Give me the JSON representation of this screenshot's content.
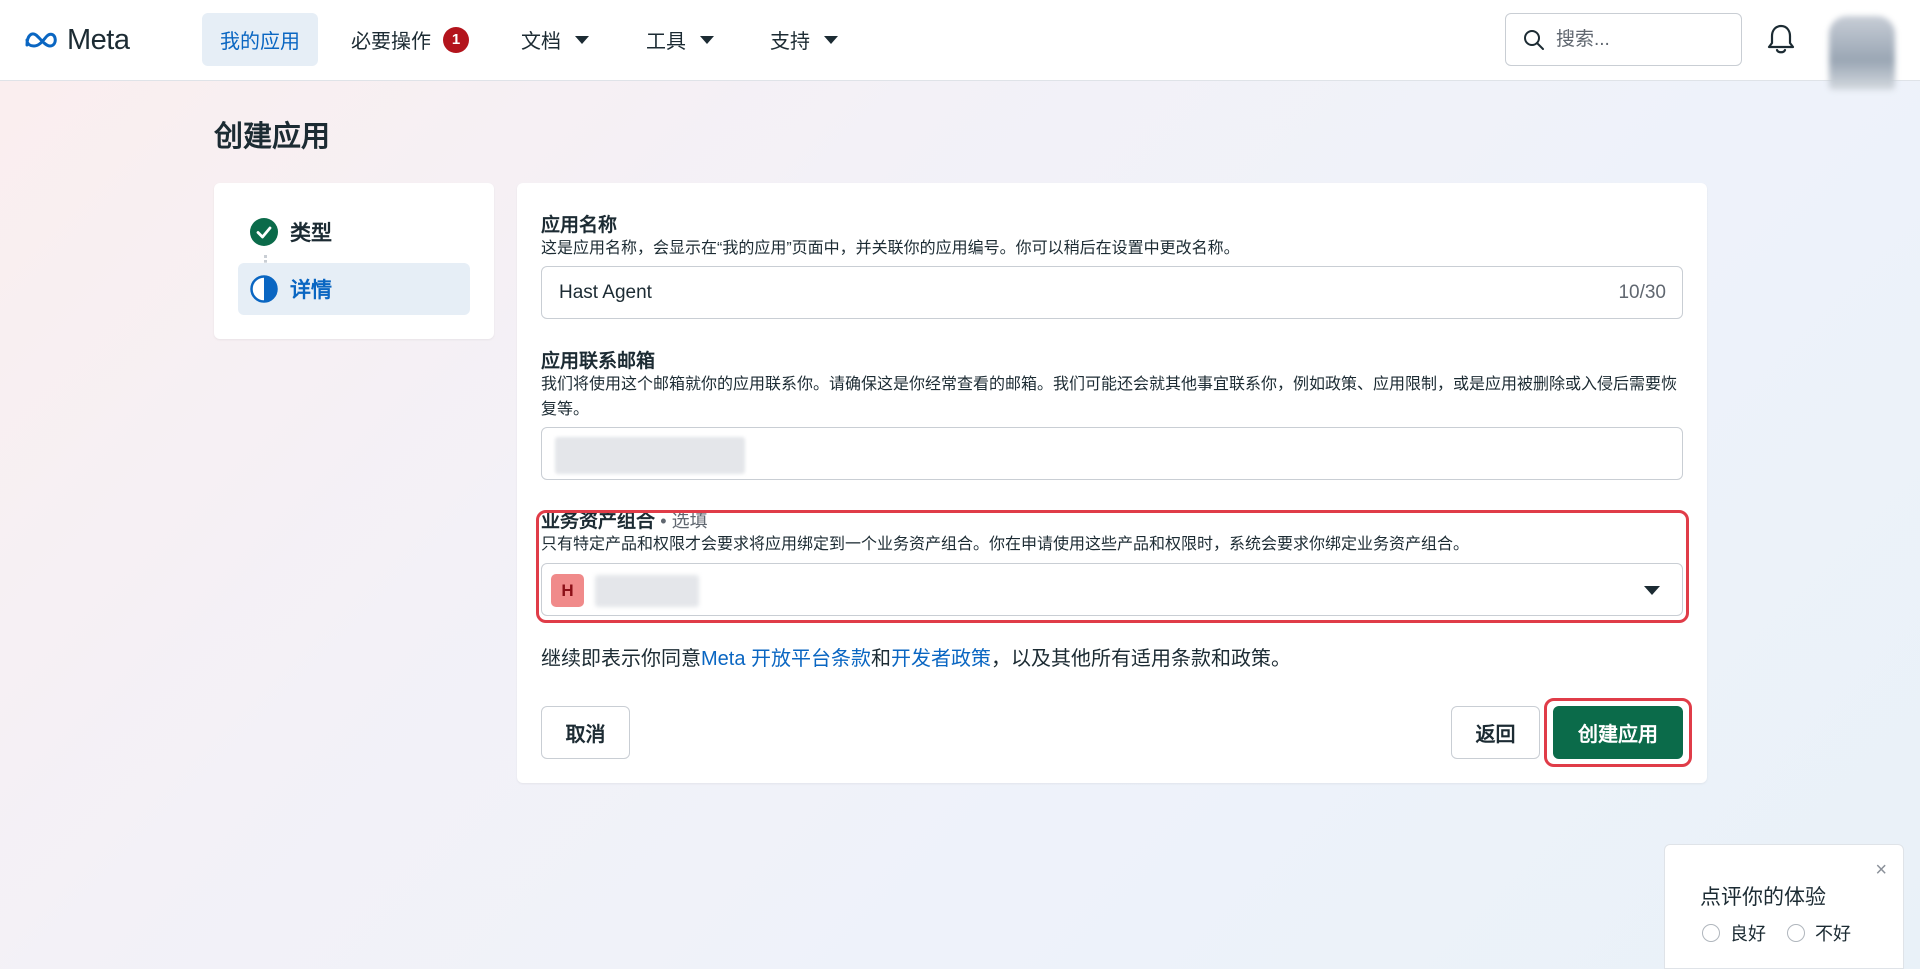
{
  "nav": {
    "brand": "Meta",
    "items": [
      {
        "label": "我的应用"
      },
      {
        "label": "必要操作",
        "badge": "1"
      },
      {
        "label": "文档"
      },
      {
        "label": "工具"
      },
      {
        "label": "支持"
      }
    ],
    "search_placeholder": "搜索..."
  },
  "page": {
    "title": "创建应用"
  },
  "steps": [
    {
      "label": "类型",
      "status": "complete"
    },
    {
      "label": "详情",
      "status": "current"
    }
  ],
  "form": {
    "app_name": {
      "label": "应用名称",
      "description": "这是应用名称，会显示在“我的应用”页面中，并关联你的应用编号。你可以稍后在设置中更改名称。",
      "value": "Hast Agent",
      "counter": "10/30"
    },
    "contact_email": {
      "label": "应用联系邮箱",
      "description": "我们将使用这个邮箱就你的应用联系你。请确保这是你经常查看的邮箱。我们可能还会就其他事宜联系你，例如政策、应用限制，或是应用被删除或入侵后需要恢复等。"
    },
    "business_portfolio": {
      "label": "业务资产组合",
      "optional": "• 选填",
      "description": "只有特定产品和权限才会要求将应用绑定到一个业务资产组合。你在申请使用这些产品和权限时，系统会要求你绑定业务资产组合。",
      "avatar_letter": "H"
    },
    "terms": {
      "prefix": "继续即表示你同意",
      "link1": "Meta 开放平台条款",
      "middle": "和",
      "link2": "开发者政策",
      "suffix": "，以及其他所有适用条款和政策。"
    },
    "buttons": {
      "cancel": "取消",
      "back": "返回",
      "create": "创建应用"
    }
  },
  "feedback": {
    "title": "点评你的体验",
    "good": "良好",
    "bad": "不好",
    "close": "×"
  },
  "colors": {
    "primary_green": "#0b6b4a",
    "link_blue": "#0a66c2",
    "highlight_red": "#e03c48",
    "badge_red": "#b3141c"
  }
}
